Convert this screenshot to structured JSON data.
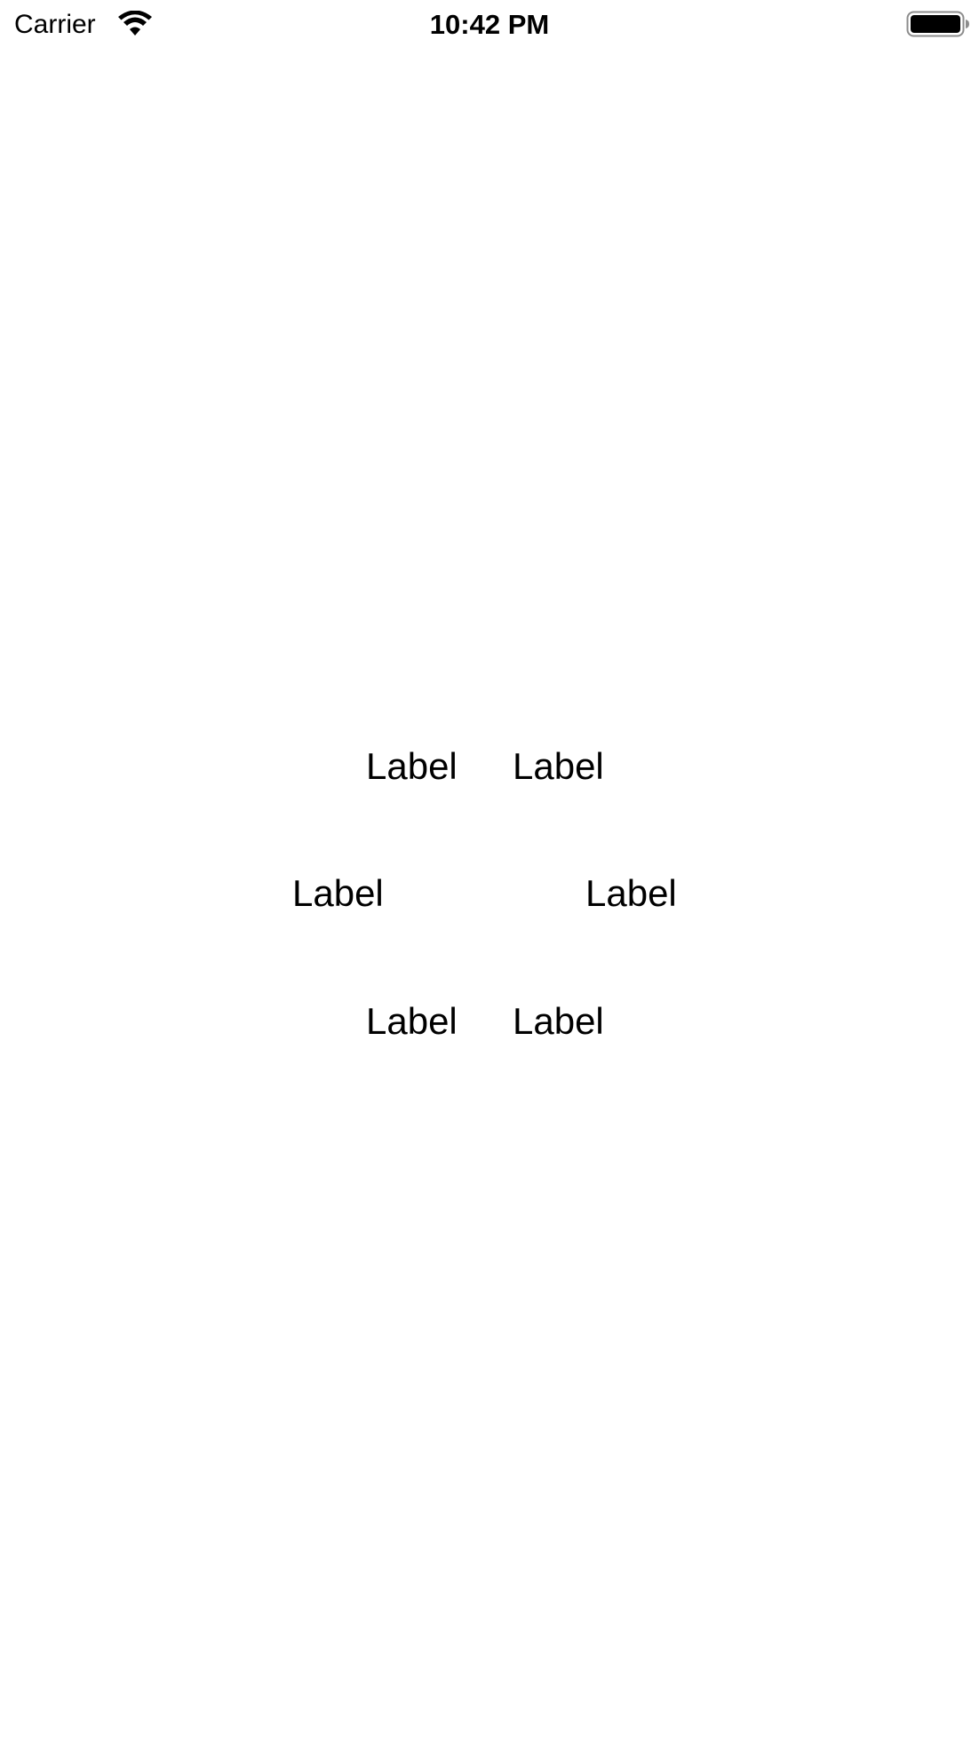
{
  "status_bar": {
    "carrier": "Carrier",
    "time": "10:42 PM",
    "wifi_icon": "wifi-icon",
    "battery_icon": "battery-full-icon"
  },
  "labels": [
    "Label",
    "Label",
    "Label",
    "Label",
    "Label",
    "Label"
  ],
  "colors": {
    "background": "#ffffff",
    "text": "#000000"
  }
}
